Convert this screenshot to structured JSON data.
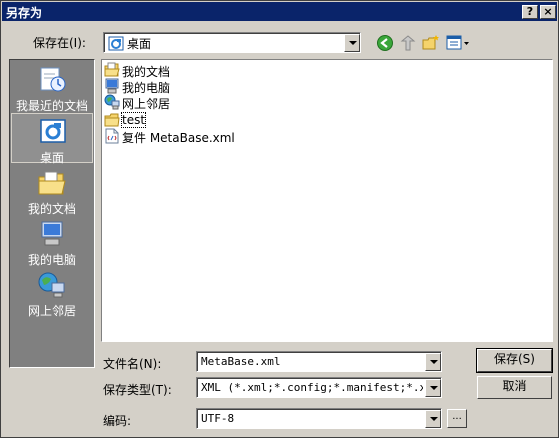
{
  "window": {
    "title": "另存为"
  },
  "titlebar": {
    "help": "?",
    "close": "×"
  },
  "save_in": {
    "label": "保存在(I):",
    "value": "桌面"
  },
  "places": [
    {
      "label": "我最近的文档",
      "icon": "recent-documents-icon"
    },
    {
      "label": "桌面",
      "icon": "desktop-icon",
      "selected": true
    },
    {
      "label": "我的文档",
      "icon": "my-documents-icon"
    },
    {
      "label": "我的电脑",
      "icon": "my-computer-icon"
    },
    {
      "label": "网上邻居",
      "icon": "network-places-icon"
    }
  ],
  "files": [
    {
      "name": "我的文档",
      "icon": "my-documents-icon"
    },
    {
      "name": "我的电脑",
      "icon": "my-computer-icon"
    },
    {
      "name": "网上邻居",
      "icon": "network-places-icon"
    },
    {
      "name": "test",
      "icon": "folder-icon"
    },
    {
      "name": "复件 MetaBase.xml",
      "icon": "xml-file-icon"
    }
  ],
  "filename": {
    "label": "文件名(N):",
    "value": "MetaBase.xml"
  },
  "filetype": {
    "label": "保存类型(T):",
    "value": "XML (*.xml;*.config;*.manifest;*.xaml"
  },
  "encoding": {
    "label": "编码:",
    "value": "UTF-8",
    "more": "..."
  },
  "buttons": {
    "save": "保存(S)",
    "cancel": "取消"
  }
}
